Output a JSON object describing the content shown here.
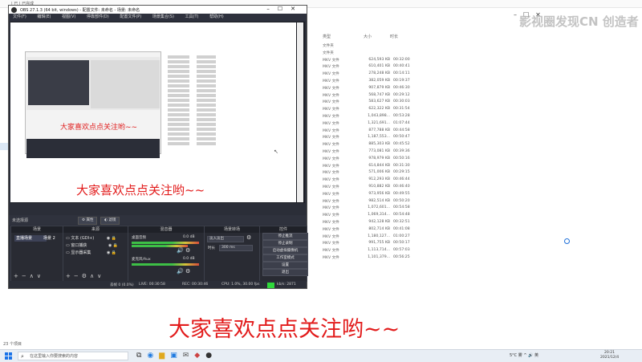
{
  "explorer": {
    "tab_label": "| 已 | 已完成",
    "columns": {
      "type": "类型",
      "size": "大小",
      "duration": "时长"
    },
    "watermark": "影视圈发现CN 创造者",
    "item_count": "23 个项目",
    "folders": [
      "文件夹",
      "文件夹"
    ],
    "files": [
      {
        "type": "MKV 文件",
        "size": "624,593 KB",
        "dur": "00:32:00"
      },
      {
        "type": "MKV 文件",
        "size": "610,401 KB",
        "dur": "00:40:41"
      },
      {
        "type": "MKV 文件",
        "size": "278,248 KB",
        "dur": "00:14:11"
      },
      {
        "type": "MKV 文件",
        "size": "382,059 KB",
        "dur": "00:19:37"
      },
      {
        "type": "MKV 文件",
        "size": "907,879 KB",
        "dur": "00:46:30"
      },
      {
        "type": "MKV 文件",
        "size": "568,747 KB",
        "dur": "00:29:12"
      },
      {
        "type": "MKV 文件",
        "size": "583,627 KB",
        "dur": "00:30:03"
      },
      {
        "type": "MKV 文件",
        "size": "622,322 KB",
        "dur": "00:31:54"
      },
      {
        "type": "MKV 文件",
        "size": "1,043,898...",
        "dur": "00:53:28"
      },
      {
        "type": "MKV 文件",
        "size": "1,321,691...",
        "dur": "01:07:44"
      },
      {
        "type": "MKV 文件",
        "size": "877,788 KB",
        "dur": "00:44:58"
      },
      {
        "type": "MKV 文件",
        "size": "1,187,553...",
        "dur": "00:50:47"
      },
      {
        "type": "MKV 文件",
        "size": "885,303 KB",
        "dur": "00:45:52"
      },
      {
        "type": "MKV 文件",
        "size": "773,081 KB",
        "dur": "00:39:36"
      },
      {
        "type": "MKV 文件",
        "size": "978,979 KB",
        "dur": "00:50:16"
      },
      {
        "type": "MKV 文件",
        "size": "614,844 KB",
        "dur": "00:31:30"
      },
      {
        "type": "MKV 文件",
        "size": "571,006 KB",
        "dur": "00:29:15"
      },
      {
        "type": "MKV 文件",
        "size": "912,293 KB",
        "dur": "00:46:44"
      },
      {
        "type": "MKV 文件",
        "size": "910,882 KB",
        "dur": "00:46:40"
      },
      {
        "type": "MKV 文件",
        "size": "973,956 KB",
        "dur": "00:49:55"
      },
      {
        "type": "MKV 文件",
        "size": "982,514 KB",
        "dur": "00:50:20"
      },
      {
        "type": "MKV 文件",
        "size": "1,072,601...",
        "dur": "00:54:58"
      },
      {
        "type": "MKV 文件",
        "size": "1,069,314...",
        "dur": "00:54:48"
      },
      {
        "type": "MKV 文件",
        "size": "942,128 KB",
        "dur": "00:32:51"
      },
      {
        "type": "MKV 文件",
        "size": "802,714 KB",
        "dur": "00:41:08"
      },
      {
        "type": "MKV 文件",
        "size": "1,180,127...",
        "dur": "01:00:27"
      },
      {
        "type": "MKV 文件",
        "size": "991,755 KB",
        "dur": "00:50:17"
      },
      {
        "type": "MKV 文件",
        "size": "1,113,714...",
        "dur": "00:57:03"
      },
      {
        "type": "MKV 文件",
        "size": "1,101,379...",
        "dur": "00:56:25"
      }
    ]
  },
  "obs": {
    "title": "OBS 27.1.3 (64 bit, windows) - 配置文件: 未命名 - 场景: 未命名",
    "menu": [
      "文件(F)",
      "编辑(E)",
      "视图(V)",
      "停靠部件(D)",
      "配置文件(P)",
      "场景集合(S)",
      "工具(T)",
      "帮助(H)"
    ],
    "inner_overlay_text": "大家喜欢点点关注哟~~",
    "canvas_text": "大家喜欢点点关注哟~~",
    "source_bar": {
      "label": "未选择源",
      "properties": "属性",
      "filters": "滤镜"
    },
    "docks": {
      "scenes": {
        "title": "场景",
        "items": [
          "直播场景",
          "场景 2"
        ]
      },
      "sources": {
        "title": "来源",
        "items": [
          "文本 (GDI+)",
          "窗口捕获",
          "显示器采集"
        ]
      },
      "mixer": {
        "title": "混音器",
        "channels": [
          {
            "name": "桌面音频",
            "db": "0.0 dB"
          },
          {
            "name": "麦克风/Aux",
            "db": "0.0 dB"
          }
        ]
      },
      "transitions": {
        "title": "场景转场",
        "type": "淡入淡出",
        "duration_label": "时长",
        "duration": "300 ms"
      },
      "controls": {
        "title": "控件",
        "buttons": [
          "停止推流",
          "停止录制",
          "启动虚拟摄像机",
          "工作室模式",
          "设置",
          "退出"
        ]
      }
    },
    "status": {
      "dropped": "丢帧 0 (0.0%)",
      "live": "LIVE: 00:30:58",
      "rec": "REC: 00:30:46",
      "cpu": "CPU: 1.0%, 30.00 fps",
      "kbps": "kb/s: 2871"
    }
  },
  "overlay_text": "大家喜欢点点关注哟~~",
  "taskbar": {
    "search_placeholder": "在这里输入你要搜索的内容",
    "tray": "5°C 雾 ^ 🔊 英",
    "time": "20:21",
    "date": "2021/12/4"
  }
}
